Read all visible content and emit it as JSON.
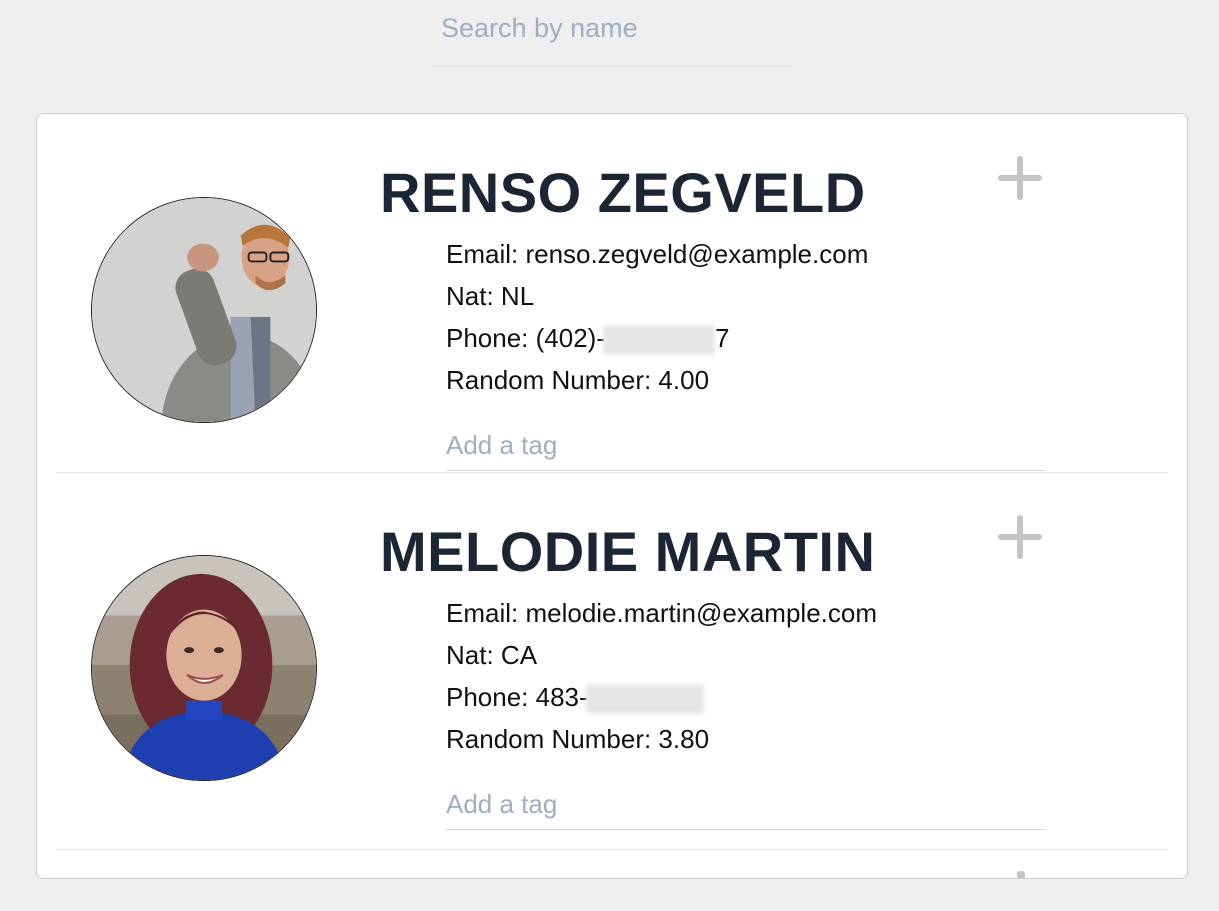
{
  "search": {
    "placeholder": "Search by name",
    "value": ""
  },
  "students": [
    {
      "name": "RENSO ZEGVELD",
      "email_label": "Email: ",
      "email": "renso.zegveld@example.com",
      "nat_label": "Nat: ",
      "nat": "NL",
      "phone_label": "Phone: ",
      "phone_visible": "(402)-",
      "phone_tail": "7",
      "random_label": "Random Number: ",
      "random_number": "4.00",
      "tag_placeholder": "Add a tag",
      "expand_icon": "plus-icon"
    },
    {
      "name": "MELODIE MARTIN",
      "email_label": "Email: ",
      "email": "melodie.martin@example.com",
      "nat_label": "Nat: ",
      "nat": "CA",
      "phone_label": "Phone: ",
      "phone_visible": "483-",
      "phone_tail": "",
      "random_label": "Random Number: ",
      "random_number": "3.80",
      "tag_placeholder": "Add a tag",
      "expand_icon": "plus-icon"
    }
  ],
  "colors": {
    "background": "#efefef",
    "card": "#ffffff",
    "name_text": "#1b2533",
    "placeholder": "#a0aec0",
    "plus_icon": "#c4c4c4"
  }
}
